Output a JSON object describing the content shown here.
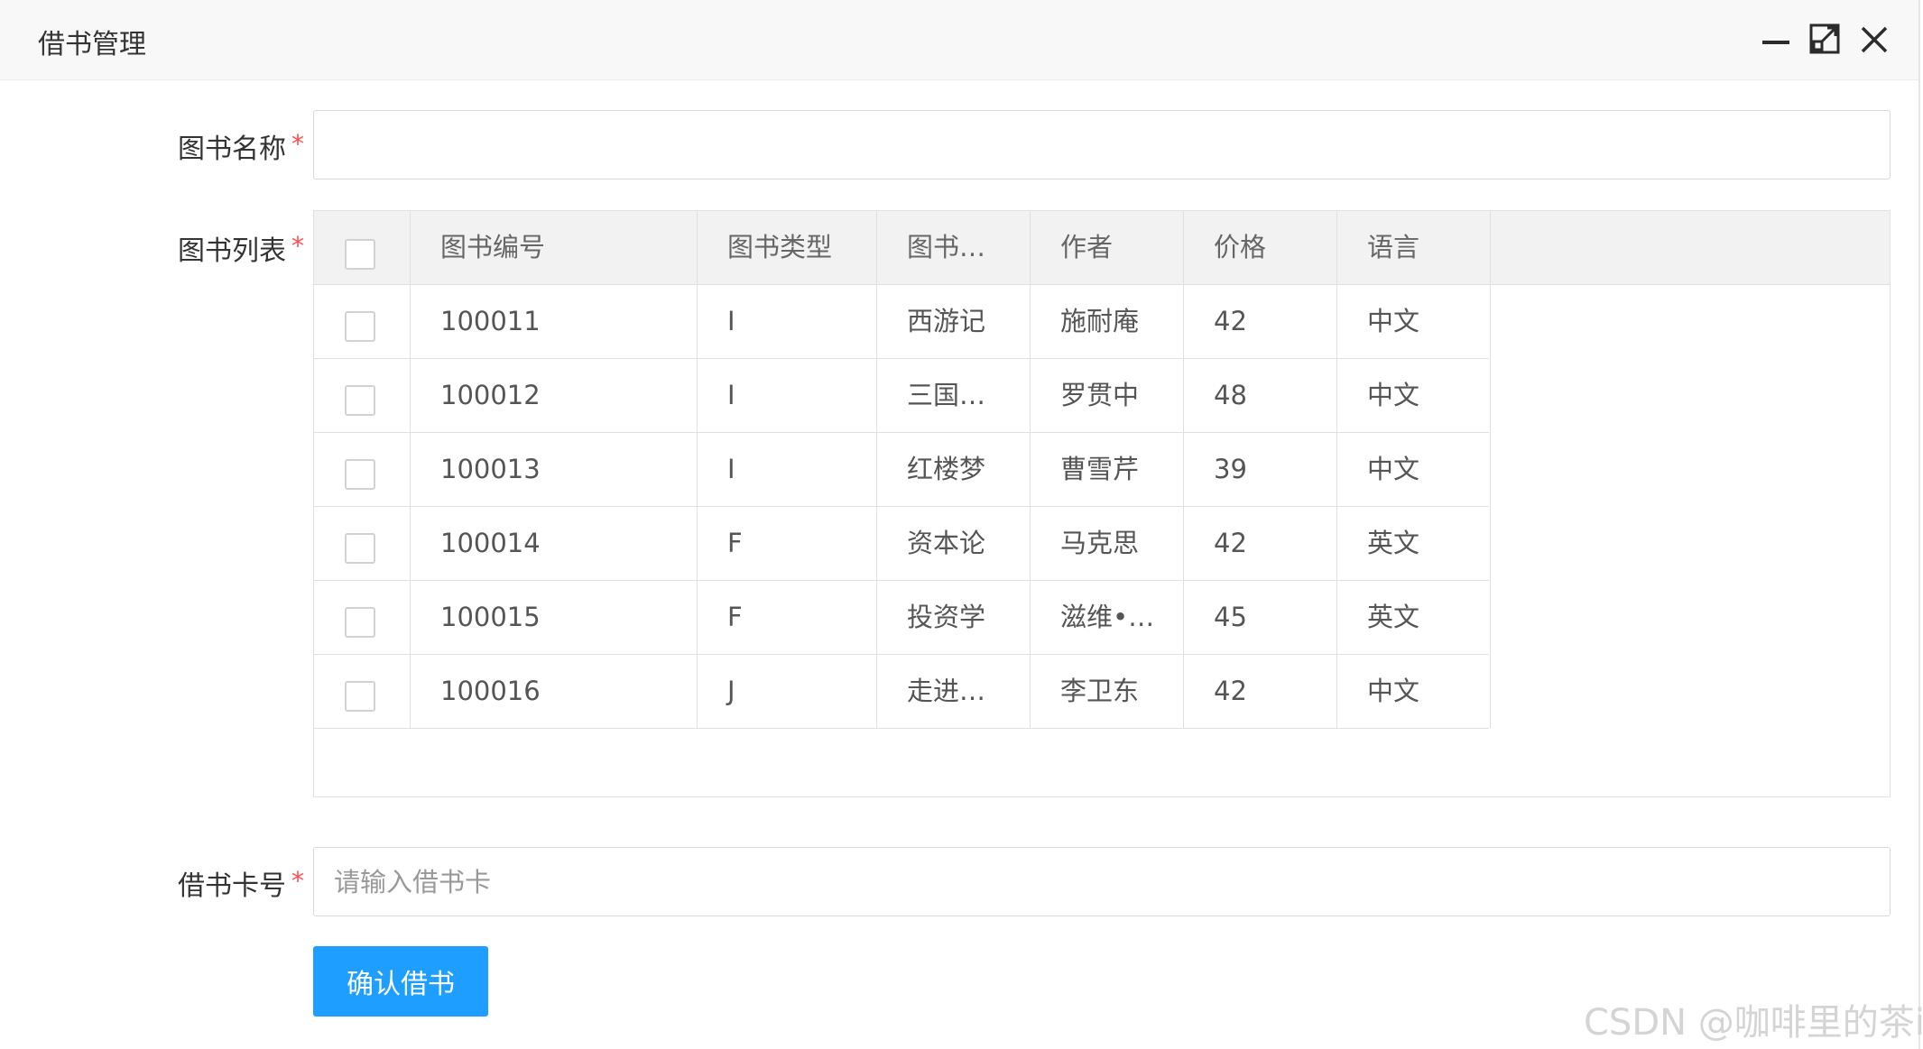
{
  "dialog": {
    "title": "借书管理"
  },
  "form": {
    "book_name": {
      "label": "图书名称",
      "required_mark": "*",
      "value": "",
      "placeholder": ""
    },
    "book_list": {
      "label": "图书列表",
      "required_mark": "*"
    },
    "card_no": {
      "label": "借书卡号",
      "required_mark": "*",
      "value": "",
      "placeholder": "请输入借书卡"
    },
    "submit_label": "确认借书"
  },
  "table": {
    "columns": [
      "图书编号",
      "图书类型",
      "图书…",
      "作者",
      "价格",
      "语言"
    ],
    "rows": [
      {
        "id": "100011",
        "type": "I",
        "name": "西游记",
        "author": "施耐庵",
        "price": "42",
        "lang": "中文",
        "checked": false
      },
      {
        "id": "100012",
        "type": "I",
        "name": "三国…",
        "author": "罗贯中",
        "price": "48",
        "lang": "中文",
        "checked": false
      },
      {
        "id": "100013",
        "type": "I",
        "name": "红楼梦",
        "author": "曹雪芹",
        "price": "39",
        "lang": "中文",
        "checked": false
      },
      {
        "id": "100014",
        "type": "F",
        "name": "资本论",
        "author": "马克思",
        "price": "42",
        "lang": "英文",
        "checked": false
      },
      {
        "id": "100015",
        "type": "F",
        "name": "投资学",
        "author": "滋维•…",
        "price": "45",
        "lang": "英文",
        "checked": false
      },
      {
        "id": "100016",
        "type": "J",
        "name": "走进…",
        "author": "李卫东",
        "price": "42",
        "lang": "中文",
        "checked": false
      }
    ]
  },
  "watermark": "CSDN @咖啡里的茶i",
  "colors": {
    "primary": "#1e9fff",
    "required": "#ff4d4f",
    "header_bg": "#f2f2f2",
    "titlebar_bg": "#f8f8f8"
  }
}
